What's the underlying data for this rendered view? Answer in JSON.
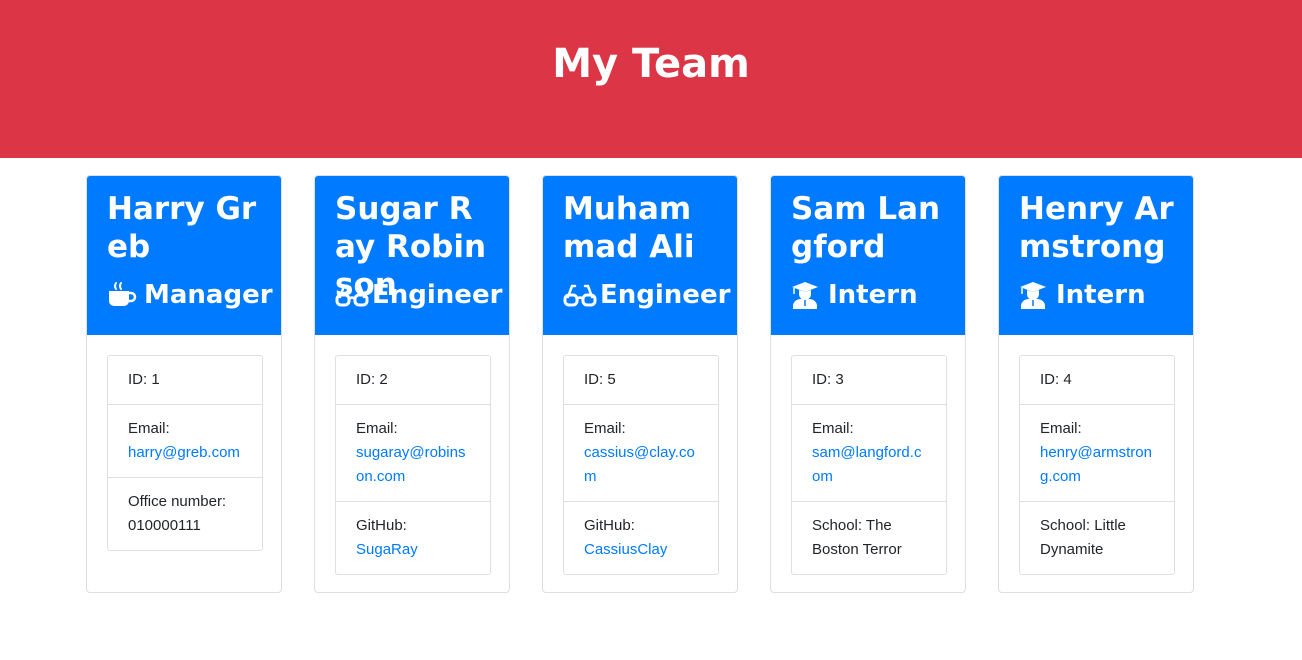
{
  "header": {
    "title": "My Team"
  },
  "colors": {
    "header_bg": "#dc3545",
    "card_header_bg": "#007bff",
    "link": "#007bff"
  },
  "cards": [
    {
      "name": "Harry Greb",
      "role": "Manager",
      "role_icon": "mug-hot-icon",
      "id_label": "ID: 1",
      "email_label": "Email:",
      "email": "harry@greb.com",
      "extra_label": "Office number:",
      "extra_value": "010000111"
    },
    {
      "name": "Sugar Ray Robinson",
      "role": "Engineer",
      "role_icon": "glasses-icon",
      "id_label": "ID: 2",
      "email_label": "Email:",
      "email": "sugaray@robinson.com",
      "extra_label": "GitHub:",
      "extra_value": "SugaRay"
    },
    {
      "name": "Muhammad Ali",
      "role": "Engineer",
      "role_icon": "glasses-icon",
      "id_label": "ID: 5",
      "email_label": "Email:",
      "email": "cassius@clay.com",
      "extra_label": "GitHub:",
      "extra_value": "CassiusClay"
    },
    {
      "name": "Sam Langford",
      "role": "Intern",
      "role_icon": "graduate-icon",
      "id_label": "ID: 3",
      "email_label": "Email:",
      "email": "sam@langford.com",
      "extra_label": "School: The Boston Terror",
      "extra_value": ""
    },
    {
      "name": "Henry Armstrong",
      "role": "Intern",
      "role_icon": "graduate-icon",
      "id_label": "ID: 4",
      "email_label": "Email:",
      "email": "henry@armstrong.com",
      "extra_label": "School: Little Dynamite",
      "extra_value": ""
    }
  ]
}
